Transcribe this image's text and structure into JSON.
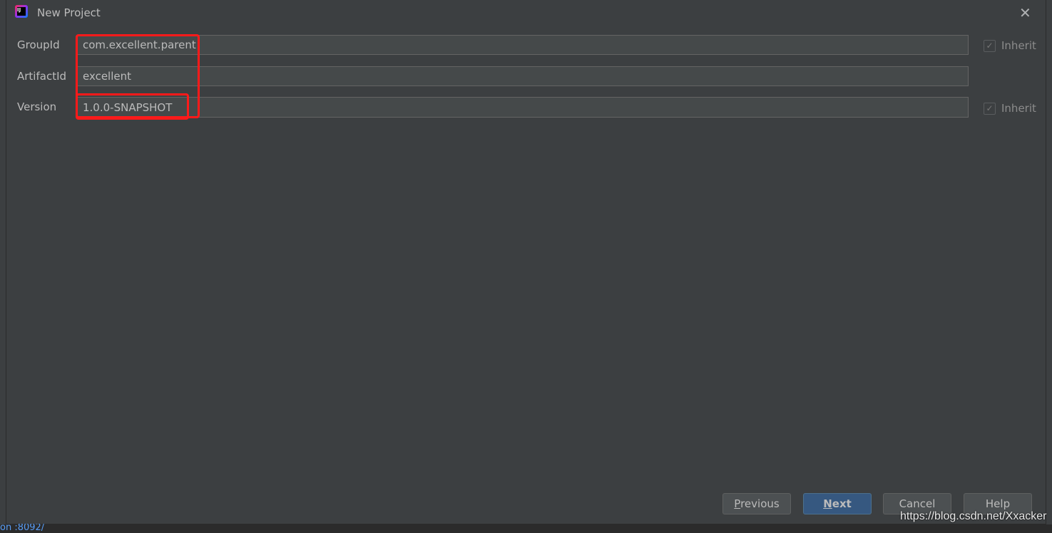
{
  "dialog": {
    "title": "New Project",
    "fields": [
      {
        "label": "GroupId",
        "value": "com.excellent.parent",
        "inherit": true
      },
      {
        "label": "ArtifactId",
        "value": "excellent"
      },
      {
        "label": "Version",
        "value": "1.0.0-SNAPSHOT",
        "inherit": true
      }
    ],
    "inherit_label": "Inherit",
    "buttons": {
      "previous_mnemonic": "P",
      "previous_rest": "revious",
      "next_mnemonic": "N",
      "next_rest": "ext",
      "cancel": "Cancel",
      "help": "Help"
    }
  },
  "background_status": "on :8092/",
  "watermark": "https://blog.csdn.net/Xxacker",
  "colors": {
    "annotation": "#ff1a1a",
    "primary_button": "#365880",
    "background": "#3c3f41"
  }
}
